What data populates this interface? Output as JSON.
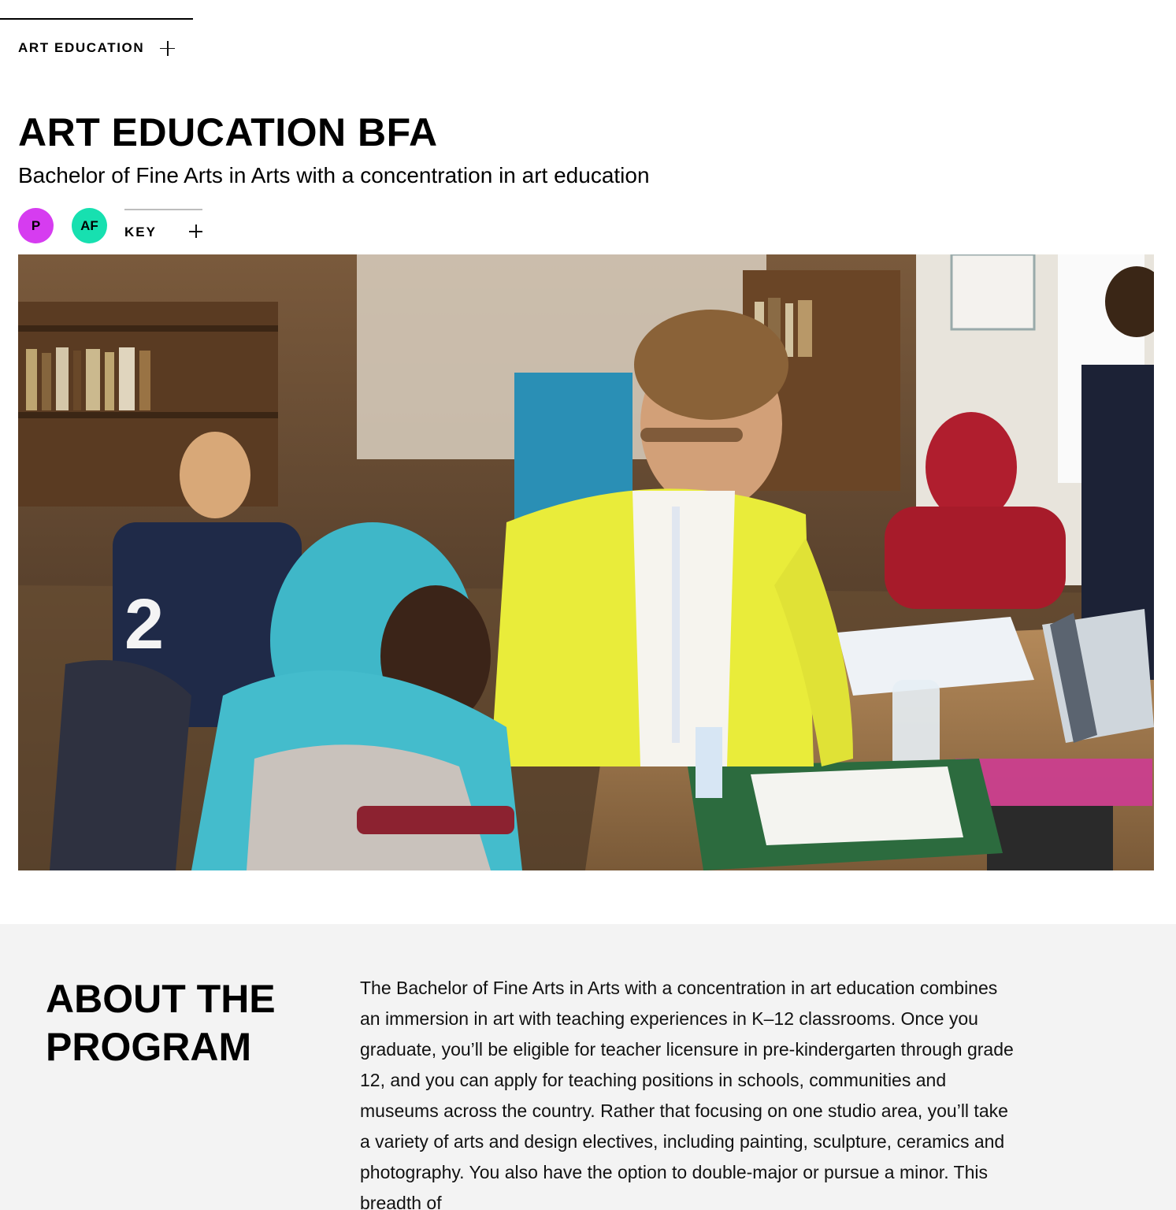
{
  "breadcrumb": {
    "label": "ART EDUCATION"
  },
  "header": {
    "title": "ART EDUCATION BFA",
    "subtitle": "Bachelor of Fine Arts in Arts with a concentration in art education"
  },
  "badges": [
    {
      "text": "P",
      "color": "#d63cf0"
    },
    {
      "text": "AF",
      "color": "#17e0b0"
    }
  ],
  "key_toggle": {
    "label": "KEY"
  },
  "hero": {
    "description": "Teacher in a yellow cardigan helping students at tables in an art classroom"
  },
  "about": {
    "heading": "ABOUT THE PROGRAM",
    "body": "The Bachelor of Fine Arts in Arts with a concentration in art education combines an immersion in art with teaching experiences in K–12 classrooms. Once you graduate, you’ll be eligible for teacher licensure in pre-kindergarten through grade 12, and you can apply for teaching positions in schools, communities and museums across the country. Rather that focusing on one studio area, you’ll take a variety of arts and design electives, including painting, sculpture, ceramics and photography. You also have the option to double-major or pursue a minor. This breadth of"
  },
  "colors": {
    "background": "#ffffff",
    "about_background": "#f3f3f3",
    "text": "#000000",
    "divider": "#bdbdbd"
  }
}
